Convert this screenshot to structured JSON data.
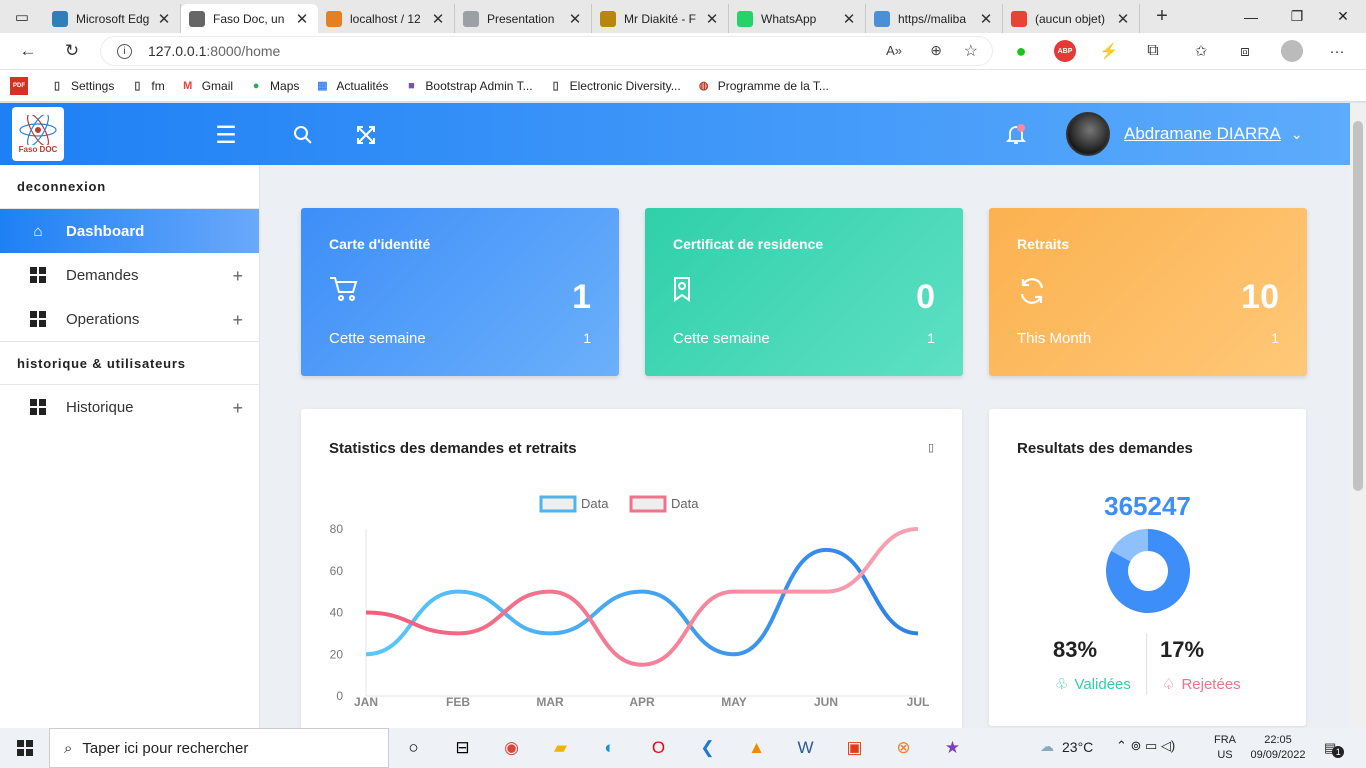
{
  "browser": {
    "tabs": [
      {
        "title": "Microsoft Edg",
        "icon": "edge-icon",
        "color": "#2f7fb8"
      },
      {
        "title": "Faso Doc, un",
        "icon": "document-icon",
        "color": "#666666"
      },
      {
        "title": "localhost / 12",
        "icon": "phpmyadmin-icon",
        "color": "#e67e22"
      },
      {
        "title": "Presentation",
        "icon": "image-icon",
        "color": "#9aa0a6"
      },
      {
        "title": "Mr Diakité - F",
        "icon": "star-icon",
        "color": "#b8860b"
      },
      {
        "title": "WhatsApp",
        "icon": "whatsapp-icon",
        "color": "#25d366"
      },
      {
        "title": "https//maliba",
        "icon": "search-icon",
        "color": "#4a90d9"
      },
      {
        "title": "(aucun objet)",
        "icon": "gmail-icon",
        "color": "#ea4335"
      }
    ],
    "url_host": "127.0.0.1",
    "url_path": ":8000/home",
    "bookmarks": [
      "Settings",
      "fm",
      "Gmail",
      "Maps",
      "Actualités",
      "Bootstrap Admin T...",
      "Electronic Diversity...",
      "Programme de la T..."
    ],
    "bookmark_icons": [
      "document-icon",
      "document-icon",
      "gmail-icon",
      "maps-pin-icon",
      "news-icon",
      "bootstrap-icon",
      "document-icon",
      "globe-icon"
    ],
    "pdf_label": "PDF",
    "abp_label": "ABP"
  },
  "app": {
    "logo_text": "Faso DOC",
    "user_name": "Abdramane DIARRA",
    "sidebar": {
      "section1": "deconnexion",
      "items1": [
        {
          "label": "Dashboard",
          "icon": "home-icon"
        },
        {
          "label": "Demandes",
          "icon": "grid-icon"
        },
        {
          "label": "Operations",
          "icon": "grid-icon"
        }
      ],
      "section2": "historique & utilisateurs",
      "items2": [
        {
          "label": "Historique",
          "icon": "grid-icon"
        }
      ]
    },
    "cards": [
      {
        "title": "Carte d'identité",
        "value": "1",
        "label": "Cette semaine",
        "sub": "1",
        "icon": "cart-icon",
        "color_from": "#3d8ef8",
        "color_to": "#6bb0fb"
      },
      {
        "title": "Certificat de residence",
        "value": "0",
        "label": "Cette semaine",
        "sub": "1",
        "icon": "bookmark-icon",
        "color_from": "#2fd0a9",
        "color_to": "#5fe0c5"
      },
      {
        "title": "Retraits",
        "value": "10",
        "label": "This Month",
        "sub": "1",
        "icon": "refresh-icon",
        "color_from": "#fbb14f",
        "color_to": "#ffc878"
      }
    ],
    "stats_panel": {
      "title": "Statistics des demandes et retraits",
      "menu_glyph": "▯"
    },
    "results_panel": {
      "title": "Resultats des demandes",
      "total": "365247",
      "valid_pct": "83%",
      "valid_label": "Validées",
      "reject_pct": "17%",
      "reject_label": "Rejetées",
      "valid_value": 83,
      "reject_value": 17,
      "valid_color": "#3d8ef8",
      "reject_color": "#8ec0fb"
    }
  },
  "chart_data": {
    "type": "line",
    "categories": [
      "JAN",
      "FEB",
      "MAR",
      "APR",
      "MAY",
      "JUN",
      "JUL"
    ],
    "series": [
      {
        "name": "Data",
        "values": [
          20,
          50,
          30,
          50,
          20,
          70,
          30
        ],
        "color": "#2f7fe8"
      },
      {
        "name": "Data",
        "values": [
          40,
          30,
          50,
          15,
          50,
          50,
          80
        ],
        "color": "#f0728c"
      }
    ],
    "ylim": [
      0,
      80
    ],
    "yticks": [
      0,
      20,
      40,
      60,
      80
    ],
    "legend": "top-center",
    "grid": false
  },
  "taskbar": {
    "search_placeholder": "Taper ici pour rechercher",
    "weather": "23°C",
    "lang1": "FRA",
    "lang2": "US",
    "time": "22:05",
    "date": "09/09/2022",
    "notif_count": "1"
  }
}
